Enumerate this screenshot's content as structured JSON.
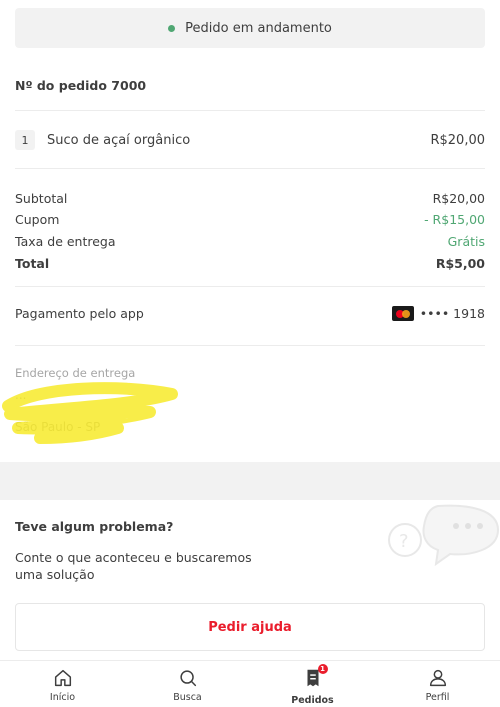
{
  "status": {
    "text": "Pedido em andamento",
    "color": "#50a773"
  },
  "order": {
    "number_label": "Nº do pedido 7000"
  },
  "items": [
    {
      "qty": "1",
      "name": "Suco de açaí orgânico",
      "price": "R$20,00"
    }
  ],
  "summary": {
    "subtotal_label": "Subtotal",
    "subtotal_value": "R$20,00",
    "coupon_label": "Cupom",
    "coupon_value": "- R$15,00",
    "delivery_label": "Taxa de entrega",
    "delivery_value": "Grátis",
    "total_label": "Total",
    "total_value": "R$5,00"
  },
  "payment": {
    "label": "Pagamento pelo app",
    "card_mask": "•••• 1918",
    "card_brand_icon": "mastercard-icon"
  },
  "address": {
    "label": "Endereço de entrega",
    "line1": "...",
    "line2": "São Paulo - SP"
  },
  "help": {
    "title": "Teve algum problema?",
    "text": "Conte o que aconteceu e buscaremos uma solução",
    "button": "Pedir ajuda",
    "accent": "#ea1d2c"
  },
  "nav": {
    "items": [
      {
        "label": "Início",
        "icon": "home-icon"
      },
      {
        "label": "Busca",
        "icon": "search-icon"
      },
      {
        "label": "Pedidos",
        "icon": "orders-icon",
        "badge": "1"
      },
      {
        "label": "Perfil",
        "icon": "profile-icon"
      }
    ]
  }
}
